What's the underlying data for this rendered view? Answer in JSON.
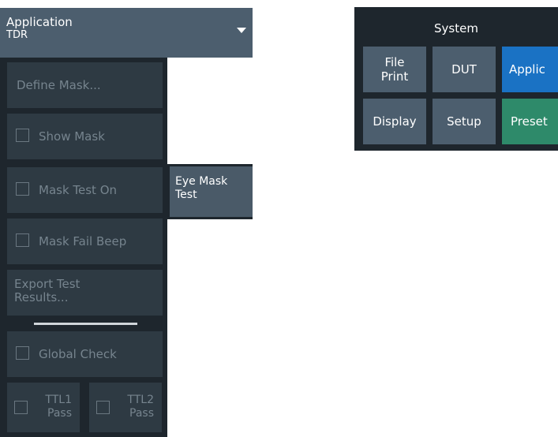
{
  "application_menu": {
    "title": "Application",
    "value": "TDR",
    "icon": "caret-down-icon"
  },
  "softkeys": {
    "define_mask": "Define Mask...",
    "show_mask": "Show Mask",
    "mask_test_on": "Mask Test On",
    "mask_fail_beep": "Mask Fail Beep",
    "export_results_line1": "Export Test",
    "export_results_line2": "Results...",
    "global_check": "Global Check",
    "ttl1_line1": "TTL1",
    "ttl1_line2": "Pass",
    "ttl2_line1": "TTL2",
    "ttl2_line2": "Pass"
  },
  "eye_tab": {
    "line1": "Eye Mask",
    "line2": "Test"
  },
  "system": {
    "title": "System",
    "file_print_line1": "File",
    "file_print_line2": "Print",
    "dut": "DUT",
    "applic": "Applic",
    "display": "Display",
    "setup": "Setup",
    "preset": "Preset"
  },
  "colors": {
    "header_bg": "#4c5e6e",
    "panel_bg": "#1e262d",
    "softkey_bg": "#2e3a43",
    "disabled_text": "#76848e",
    "accent_blue": "#1a72c4",
    "accent_green": "#2e8a6a"
  }
}
